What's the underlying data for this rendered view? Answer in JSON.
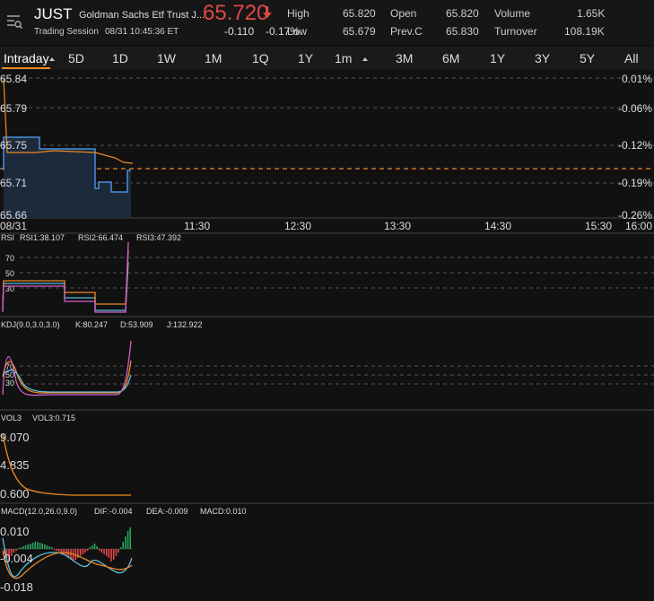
{
  "header": {
    "symbol": "JUST",
    "name": "Goldman Sachs Etf Trust J...",
    "price": "65.720",
    "session_label": "Trading Session",
    "session_time": "08/31 10:45:36 ET",
    "change": "-0.110",
    "change_pct": "-0.17%",
    "stats": [
      {
        "label": "High",
        "value": "65.820"
      },
      {
        "label": "Low",
        "value": "65.679"
      },
      {
        "label": "Open",
        "value": "65.820"
      },
      {
        "label": "Prev.C",
        "value": "65.830"
      },
      {
        "label": "Volume",
        "value": "1.65K"
      },
      {
        "label": "Turnover",
        "value": "108.19K"
      }
    ]
  },
  "tabs": [
    "Intraday",
    "5D",
    "1D",
    "1W",
    "1M",
    "1Q",
    "1Y",
    "1m",
    "3M",
    "6M",
    "1Y",
    "3Y",
    "5Y",
    "All"
  ],
  "active_tab": "Intraday",
  "colors": {
    "up": "#26a65b",
    "down": "#e04848",
    "accent": "#f08a24",
    "blue": "#4a90e2",
    "magenta": "#d45fd0",
    "cyan": "#5bc0de"
  },
  "price_panel": {
    "left_labels": [
      "65.84",
      "65.79",
      "65.75",
      "65.71",
      "65.66"
    ],
    "right_labels": [
      "0.01%",
      "-0.06%",
      "-0.12%",
      "-0.19%",
      "-0.26%"
    ],
    "time_labels": [
      "08/31",
      "11:30",
      "12:30",
      "13:30",
      "14:30",
      "15:30",
      "16:00"
    ]
  },
  "rsi": {
    "title": "RSI",
    "items": [
      "RSI1:38.107",
      "RSI2:66.474",
      "RSI3:47.392"
    ],
    "levels": [
      "70",
      "50",
      "30"
    ]
  },
  "kdj": {
    "title": "KDJ(9.0,3.0,3.0)",
    "items": [
      "K:80.247",
      "D:53.909",
      "J:132.922"
    ],
    "levels": [
      "70",
      "50",
      "30"
    ]
  },
  "vol": {
    "title": "VOL3",
    "items": [
      "VOL3:0.715"
    ],
    "levels": [
      "9.070",
      "4.835",
      "0.600"
    ]
  },
  "macd": {
    "title": "MACD(12.0,26.0,9.0)",
    "items": [
      "DIF:-0.004",
      "DEA:-0.009",
      "MACD:0.010"
    ],
    "levels": [
      "0.010",
      "-0.004",
      "-0.018"
    ]
  }
}
